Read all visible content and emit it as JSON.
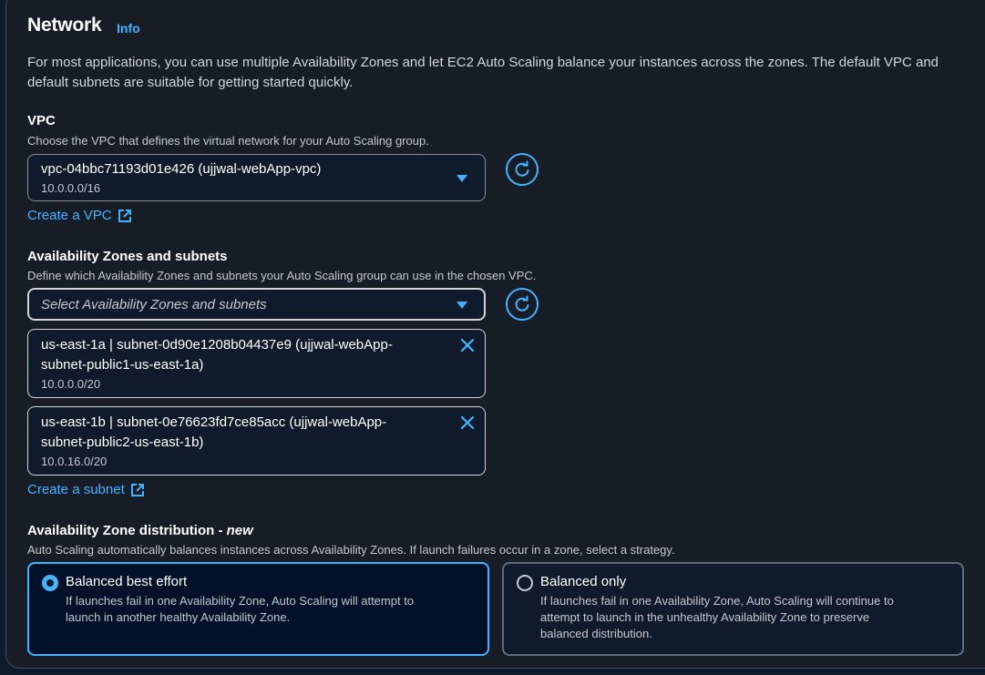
{
  "network": {
    "title": "Network",
    "info": "Info",
    "description": "For most applications, you can use multiple Availability Zones and let EC2 Auto Scaling balance your instances across the zones. The default VPC and default subnets are suitable for getting started quickly."
  },
  "vpc": {
    "label": "VPC",
    "hint": "Choose the VPC that defines the virtual network for your Auto Scaling group.",
    "selected_value": "vpc-04bbc71193d01e426 (ujjwal-webApp-vpc)",
    "selected_cidr": "10.0.0.0/16",
    "create_link": "Create a VPC"
  },
  "az": {
    "label": "Availability Zones and subnets",
    "hint": "Define which Availability Zones and subnets your Auto Scaling group can use in the chosen VPC.",
    "placeholder": "Select Availability Zones and subnets",
    "tokens": [
      {
        "line1": "us-east-1a | subnet-0d90e1208b04437e9 (ujjwal-webApp-",
        "line2": "subnet-public1-us-east-1a)",
        "cidr": "10.0.0.0/20"
      },
      {
        "line1": "us-east-1b | subnet-0e76623fd7ce85acc (ujjwal-webApp-",
        "line2": "subnet-public2-us-east-1b)",
        "cidr": "10.0.16.0/20"
      }
    ],
    "create_link": "Create a subnet"
  },
  "distribution": {
    "label": "Availability Zone distribution - ",
    "label_new": "new",
    "hint": "Auto Scaling automatically balances instances across Availability Zones. If launch failures occur in a zone, select a strategy.",
    "options": [
      {
        "title": "Balanced best effort",
        "desc1": "If launches fail in one Availability Zone, Auto Scaling will attempt to",
        "desc2": "launch in another healthy Availability Zone.",
        "desc3": "",
        "selected": true
      },
      {
        "title": "Balanced only",
        "desc1": "If launches fail in one Availability Zone, Auto Scaling will continue to",
        "desc2": "attempt to launch in the unhealthy Availability Zone to preserve",
        "desc3": "balanced distribution.",
        "selected": false
      }
    ]
  },
  "colors": {
    "accent": "#42b4ff",
    "background": "#0f1b2a",
    "panel": "#161d26"
  }
}
